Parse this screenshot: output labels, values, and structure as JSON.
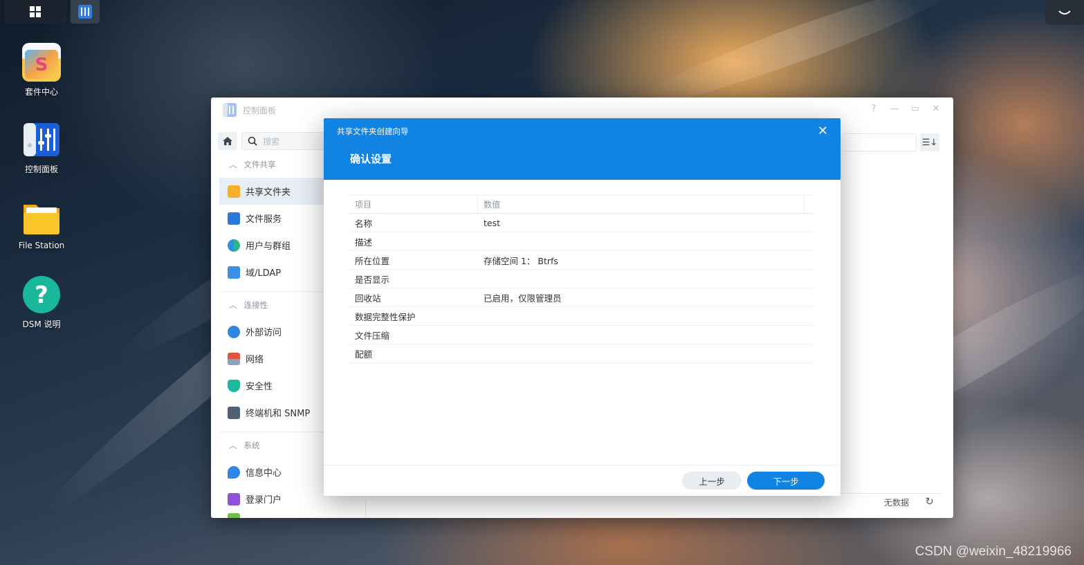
{
  "desktop": {
    "icons": [
      {
        "label": "套件中心",
        "icon": "package-center-icon"
      },
      {
        "label": "控制面板",
        "icon": "control-panel-icon"
      },
      {
        "label": "File Station",
        "icon": "file-station-icon"
      },
      {
        "label": "DSM 说明",
        "icon": "help-icon"
      }
    ]
  },
  "control_panel": {
    "title": "控制面板",
    "search_placeholder": "搜索",
    "sections": [
      {
        "title": "文件共享",
        "items": [
          "共享文件夹",
          "文件服务",
          "用户与群组",
          "域/LDAP"
        ]
      },
      {
        "title": "连接性",
        "items": [
          "外部访问",
          "网络",
          "安全性",
          "终端机和 SNMP"
        ]
      },
      {
        "title": "系统",
        "items": [
          "信息中心",
          "登录门户"
        ]
      }
    ],
    "footer_status": "无数据"
  },
  "wizard": {
    "title": "共享文件夹创建向导",
    "subtitle": "确认设置",
    "columns": {
      "item": "项目",
      "value": "数值"
    },
    "rows": [
      {
        "key": "名称",
        "value": "test"
      },
      {
        "key": "描述",
        "value": ""
      },
      {
        "key": "所在位置",
        "value": "存储空间 1： Btrfs"
      },
      {
        "key": "是否显示",
        "value": ""
      },
      {
        "key": "回收站",
        "value": "已启用，仅限管理员"
      },
      {
        "key": "数据完整性保护",
        "value": ""
      },
      {
        "key": "文件压缩",
        "value": ""
      },
      {
        "key": "配额",
        "value": ""
      }
    ],
    "prev_label": "上一步",
    "next_label": "下一步"
  },
  "watermark": "CSDN @weixin_48219966",
  "colors": {
    "accent": "#1083e3"
  }
}
